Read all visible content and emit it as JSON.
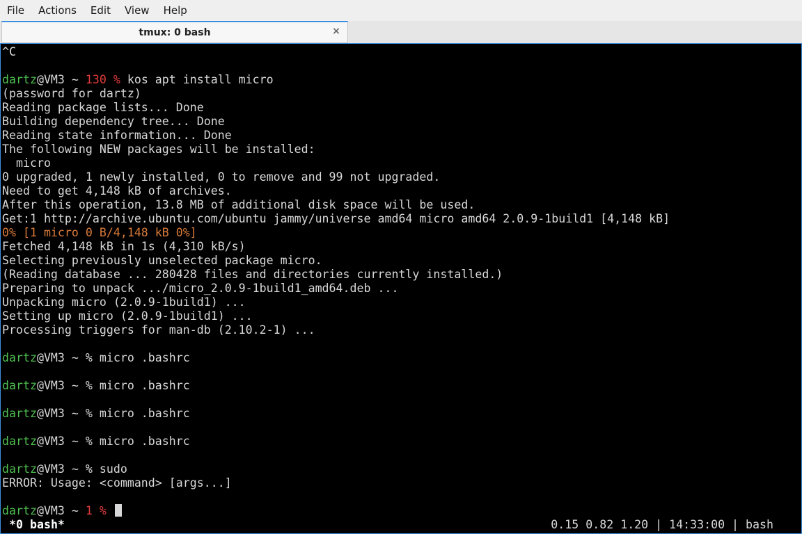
{
  "menu": {
    "items": [
      "File",
      "Actions",
      "Edit",
      "View",
      "Help"
    ]
  },
  "tab": {
    "title": "tmux: 0 bash",
    "close_glyph": "×"
  },
  "terminal": {
    "lines": [
      [
        {
          "t": "^C"
        }
      ],
      [],
      [
        {
          "t": "dartz",
          "c": "green"
        },
        {
          "t": "@VM3 ~ "
        },
        {
          "t": "130 %",
          "c": "red"
        },
        {
          "t": " kos apt install micro"
        }
      ],
      [
        {
          "t": "(password for dartz)"
        }
      ],
      [
        {
          "t": "Reading package lists... Done"
        }
      ],
      [
        {
          "t": "Building dependency tree... Done"
        }
      ],
      [
        {
          "t": "Reading state information... Done"
        }
      ],
      [
        {
          "t": "The following NEW packages will be installed:"
        }
      ],
      [
        {
          "t": "  micro"
        }
      ],
      [
        {
          "t": "0 upgraded, 1 newly installed, 0 to remove and 99 not upgraded."
        }
      ],
      [
        {
          "t": "Need to get 4,148 kB of archives."
        }
      ],
      [
        {
          "t": "After this operation, 13.8 MB of additional disk space will be used."
        }
      ],
      [
        {
          "t": "Get:1 http://archive.ubuntu.com/ubuntu jammy/universe amd64 micro amd64 2.0.9-1build1 [4,148 kB]"
        }
      ],
      [
        {
          "t": "0% [1 micro 0 B/4,148 kB 0%]",
          "c": "orange"
        }
      ],
      [
        {
          "t": "Fetched 4,148 kB in 1s (4,310 kB/s)"
        }
      ],
      [
        {
          "t": "Selecting previously unselected package micro."
        }
      ],
      [
        {
          "t": "(Reading database ... 280428 files and directories currently installed.)"
        }
      ],
      [
        {
          "t": "Preparing to unpack .../micro_2.0.9-1build1_amd64.deb ..."
        }
      ],
      [
        {
          "t": "Unpacking micro (2.0.9-1build1) ..."
        }
      ],
      [
        {
          "t": "Setting up micro (2.0.9-1build1) ..."
        }
      ],
      [
        {
          "t": "Processing triggers for man-db (2.10.2-1) ..."
        }
      ],
      [],
      [
        {
          "t": "dartz",
          "c": "green"
        },
        {
          "t": "@VM3 ~ % micro .bashrc"
        }
      ],
      [],
      [
        {
          "t": "dartz",
          "c": "green"
        },
        {
          "t": "@VM3 ~ % micro .bashrc"
        }
      ],
      [],
      [
        {
          "t": "dartz",
          "c": "green"
        },
        {
          "t": "@VM3 ~ % micro .bashrc"
        }
      ],
      [],
      [
        {
          "t": "dartz",
          "c": "green"
        },
        {
          "t": "@VM3 ~ % micro .bashrc"
        }
      ],
      [],
      [
        {
          "t": "dartz",
          "c": "green"
        },
        {
          "t": "@VM3 ~ % sudo"
        }
      ],
      [
        {
          "t": "ERROR: Usage: <command> [args...]"
        }
      ],
      [],
      [
        {
          "t": "dartz",
          "c": "green"
        },
        {
          "t": "@VM3 ~ "
        },
        {
          "t": "1 %",
          "c": "red"
        },
        {
          "t": " "
        }
      ]
    ]
  },
  "status": {
    "left": "*0 bash*",
    "right": "0.15 0.82 1.20 | 14:33:00 | bash"
  },
  "colors": {
    "green": "#4fbf4f",
    "red": "#e03c3c",
    "orange": "#d97a3a",
    "accent": "#3d8fe0"
  }
}
